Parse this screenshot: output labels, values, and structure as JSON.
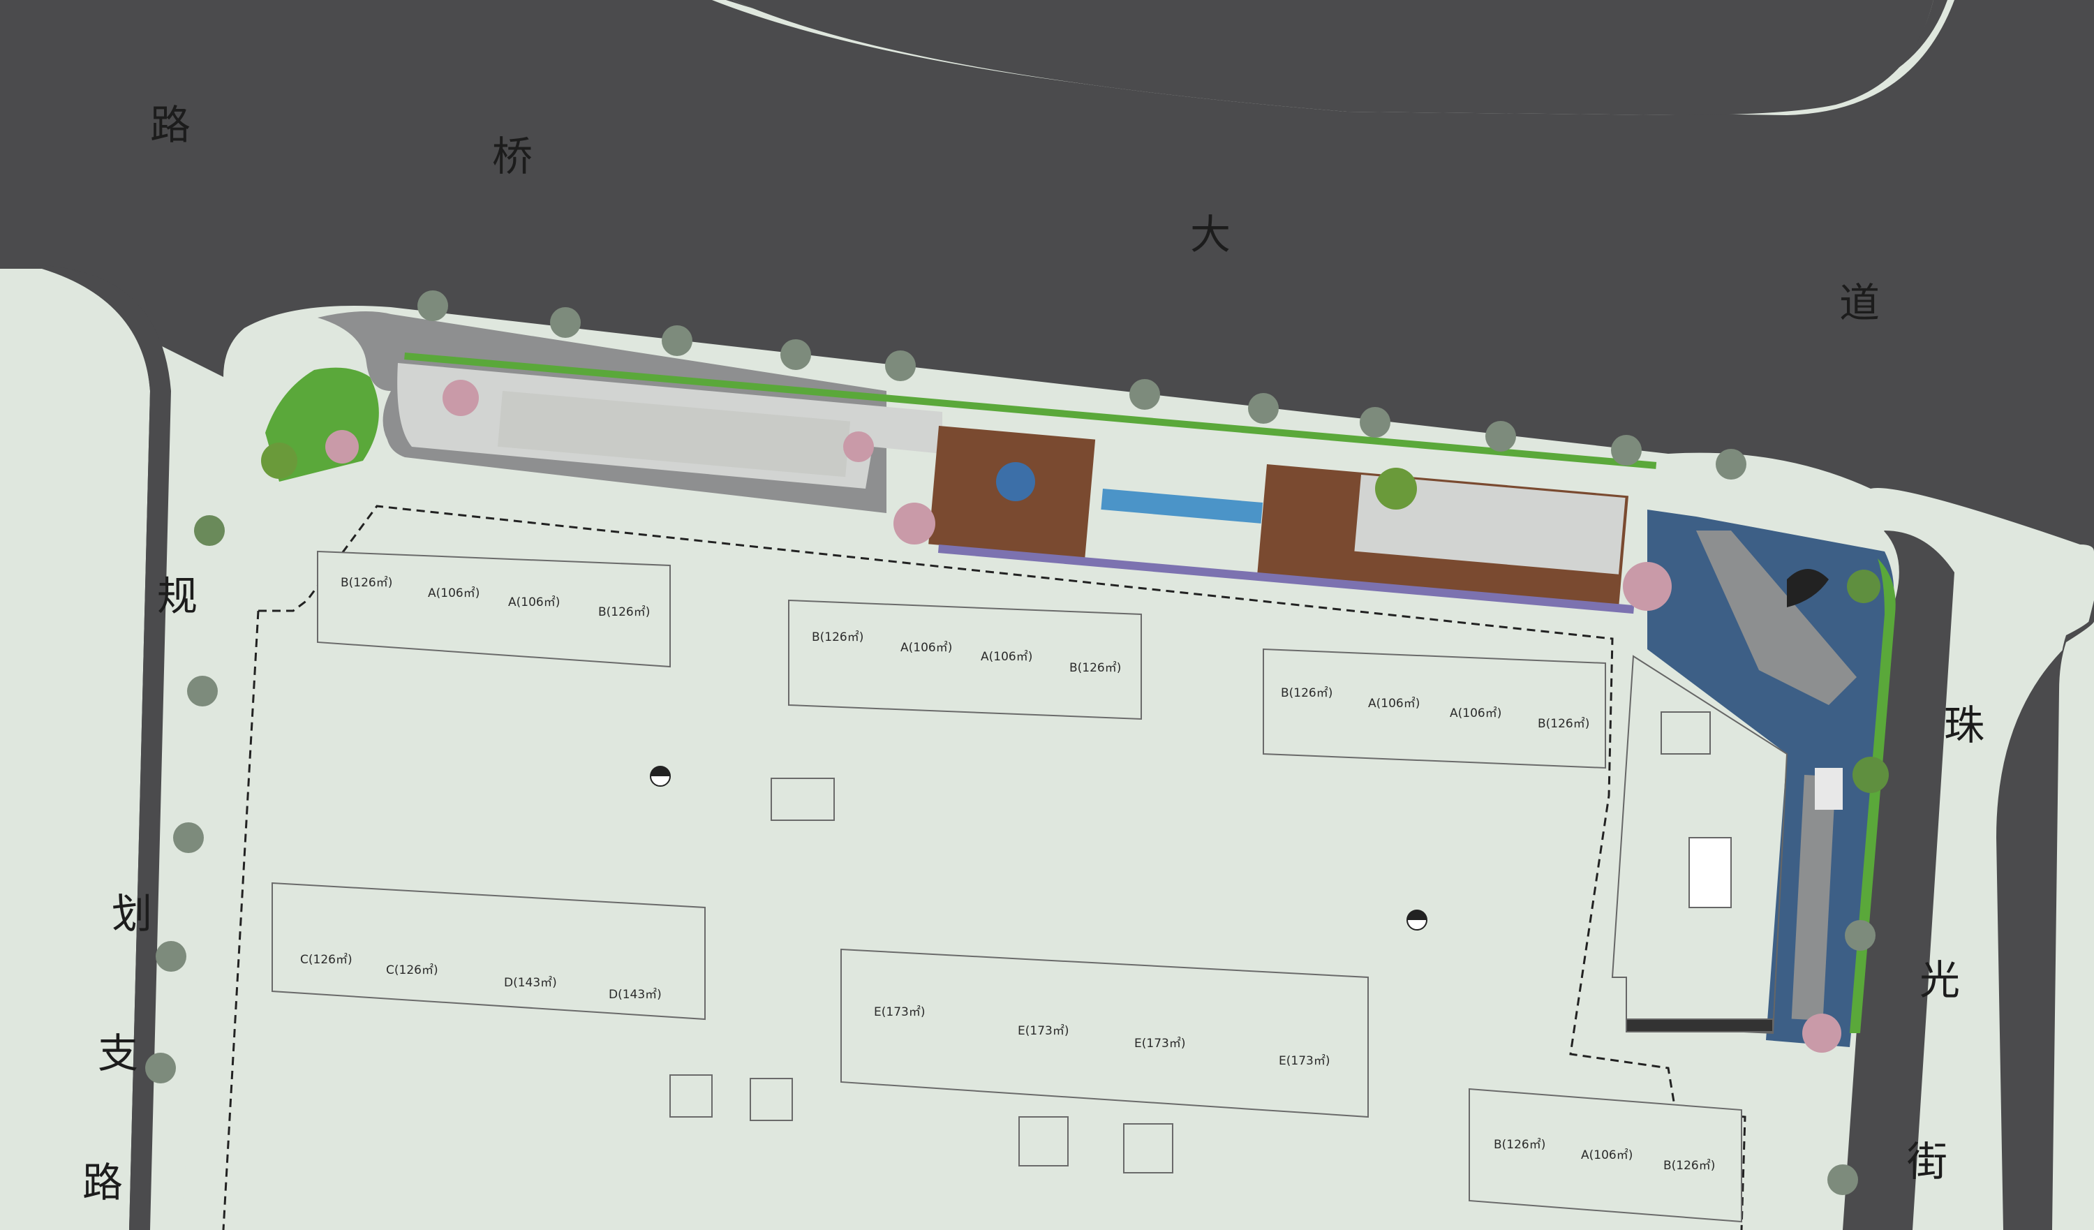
{
  "streets": {
    "north": [
      "桥",
      "大",
      "道",
      "路"
    ],
    "west": [
      "规",
      "划",
      "支",
      "路"
    ],
    "east": [
      "珠",
      "光",
      "街"
    ]
  },
  "units": [
    {
      "id": "u1",
      "label": "B(126㎡)"
    },
    {
      "id": "u2",
      "label": "A(106㎡)"
    },
    {
      "id": "u3",
      "label": "A(106㎡)"
    },
    {
      "id": "u4",
      "label": "B(126㎡)"
    },
    {
      "id": "u5",
      "label": "B(126㎡)"
    },
    {
      "id": "u6",
      "label": "A(106㎡)"
    },
    {
      "id": "u7",
      "label": "A(106㎡)"
    },
    {
      "id": "u8",
      "label": "B(126㎡)"
    },
    {
      "id": "u9",
      "label": "B(126㎡)"
    },
    {
      "id": "u10",
      "label": "A(106㎡)"
    },
    {
      "id": "u11",
      "label": "A(106㎡)"
    },
    {
      "id": "u12",
      "label": "B(126㎡)"
    },
    {
      "id": "u13",
      "label": "C(126㎡)"
    },
    {
      "id": "u14",
      "label": "C(126㎡)"
    },
    {
      "id": "u15",
      "label": "D(143㎡)"
    },
    {
      "id": "u16",
      "label": "D(143㎡)"
    },
    {
      "id": "u17",
      "label": "E(173㎡)"
    },
    {
      "id": "u18",
      "label": "E(173㎡)"
    },
    {
      "id": "u19",
      "label": "E(173㎡)"
    },
    {
      "id": "u20",
      "label": "E(173㎡)"
    },
    {
      "id": "u21",
      "label": "B(126㎡)"
    },
    {
      "id": "u22",
      "label": "A(106㎡)"
    },
    {
      "id": "u23",
      "label": "B(126㎡)"
    }
  ],
  "colors": {
    "road": "#4b4b4d",
    "site": "#dfe7de",
    "deck": "#7a4a30",
    "water": "#3d5f86",
    "lawn": "#5aa83a",
    "paving": "#d2d4d2"
  }
}
